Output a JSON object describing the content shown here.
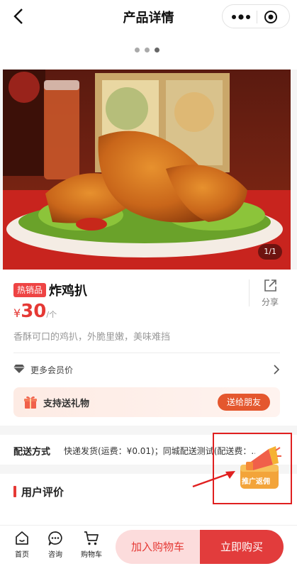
{
  "nav_bar": {
    "title": "产品详情",
    "back_icon": "chevron-left-icon",
    "more_icon": "more-dots-icon",
    "close_icon": "record-icon"
  },
  "gallery": {
    "dots": 3,
    "counter": "1/1"
  },
  "product": {
    "tag": "热销品",
    "name": "炸鸡扒",
    "currency": "¥",
    "price": "30",
    "unit": "/个",
    "description": "香酥可口的鸡扒，外脆里嫩，美味难挡",
    "share_label": "分享",
    "member_label": "更多会员价",
    "gift_label": "支持送礼物",
    "gift_button": "送给朋友"
  },
  "shipping": {
    "label": "配送方式",
    "value": "快递发货(运费：¥0.01)；同城配送测试(配送费：..."
  },
  "reviews": {
    "title": "用户评价"
  },
  "promo": {
    "label": "推广返佣"
  },
  "bottom_bar": {
    "nav": [
      {
        "label": "首页",
        "icon": "home-icon"
      },
      {
        "label": "咨询",
        "icon": "chat-icon"
      },
      {
        "label": "购物车",
        "icon": "cart-icon"
      }
    ],
    "add_to_cart": "加入购物车",
    "buy_now": "立即购买"
  },
  "colors": {
    "accent": "#e53935",
    "gift_button": "#e4572e",
    "buy_button": "#e23c3c",
    "cart_button_bg": "#fcdcdc"
  }
}
